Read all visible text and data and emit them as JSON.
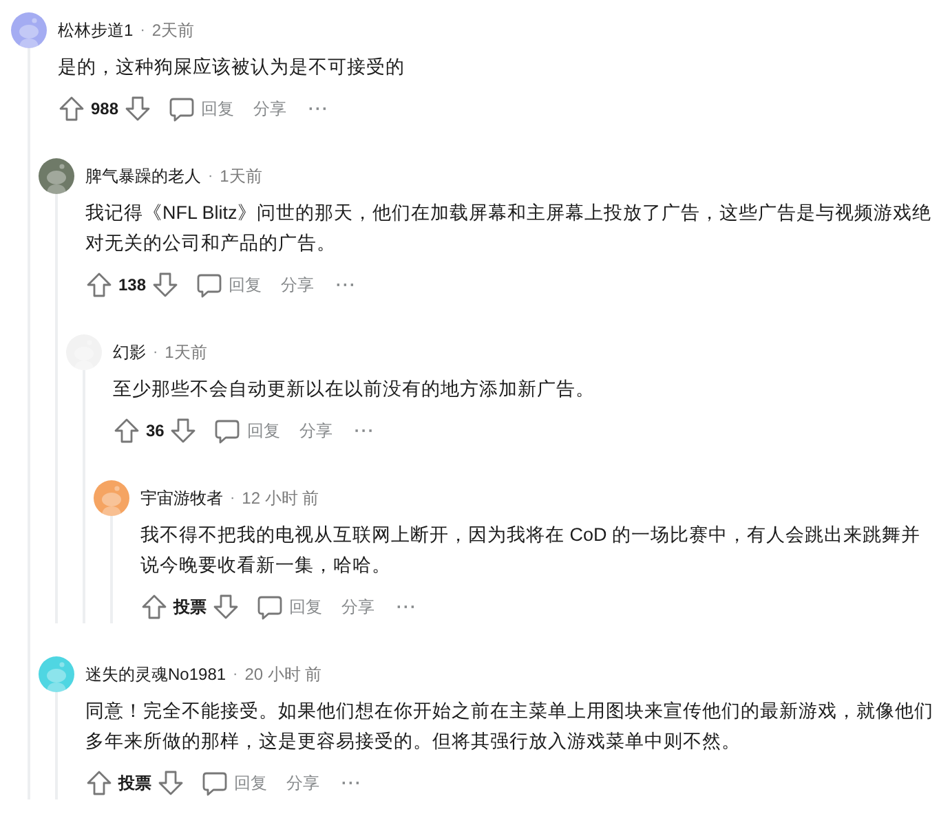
{
  "comments": [
    {
      "author": "松林步道1",
      "separator": "·",
      "time": "2天前",
      "color": "#a4acf2",
      "body": [
        "是的，这种狗屎应该被认为是不可接受的"
      ],
      "vote": "988",
      "reply": "回复",
      "share": "分享",
      "more": "···",
      "children": [
        {
          "author": "脾气暴躁的老人",
          "separator": "·",
          "time": "1天前",
          "color": "#6f7a68",
          "body": [
            "我记得《NFL Blitz》问世的那天，他们在加载屏幕和主屏幕上投放了广告，这些广告是与视频游戏绝",
            "对无关的公司和产品的广告。"
          ],
          "vote": "138",
          "reply": "回复",
          "share": "分享",
          "more": "···",
          "children": [
            {
              "author": "幻影",
              "separator": "·",
              "time": "1天前",
              "color": "#f2f2f2",
              "body": [
                "至少那些不会自动更新以在以前没有的地方添加新广告。"
              ],
              "vote": "36",
              "reply": "回复",
              "share": "分享",
              "more": "···",
              "children": [
                {
                  "author": "宇宙游牧者",
                  "separator": "·",
                  "time": "12 小时 前",
                  "color": "#f5a462",
                  "body": [
                    "我不得不把我的电视从互联网上断开，因为我将在 CoD 的一场比赛中，有人会跳出来跳舞并",
                    "说今晚要收看新一集，哈哈。"
                  ],
                  "vote": "投票",
                  "reply": "回复",
                  "share": "分享",
                  "more": "···"
                }
              ]
            }
          ]
        },
        {
          "author": "迷失的灵魂No1981",
          "separator": "·",
          "time": "20 小时 前",
          "color": "#4fd6e2",
          "body": [
            "同意！完全不能接受。如果他们想在你开始之前在主菜单上用图块来宣传他们的最新游戏，就像他们",
            "多年来所做的那样，这是更容易接受的。但将其强行放入游戏菜单中则不然。"
          ],
          "vote": "投票",
          "reply": "回复",
          "share": "分享",
          "more": "···"
        }
      ]
    }
  ]
}
